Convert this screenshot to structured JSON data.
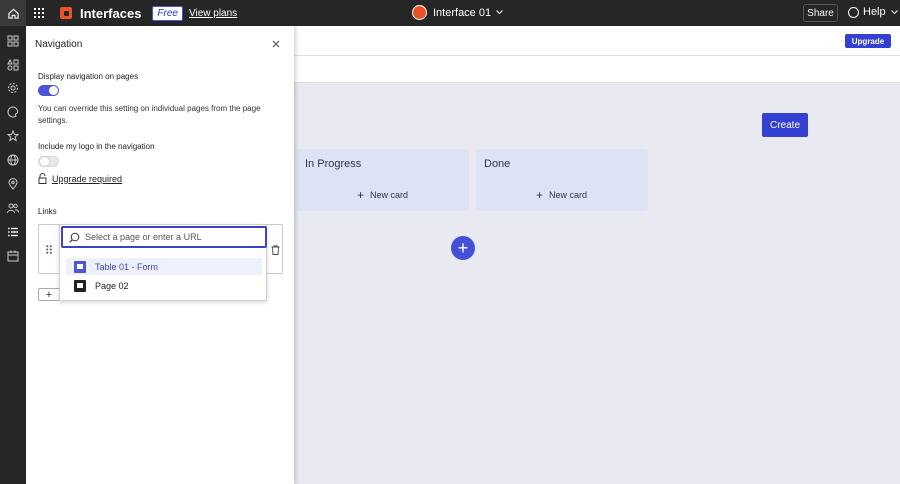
{
  "topbar": {
    "brand": "Interfaces",
    "plan_badge": "Free",
    "view_plans": "View plans",
    "interface_name": "Interface 01",
    "share": "Share",
    "help": "Help"
  },
  "background": {
    "upgrade": "Upgrade",
    "create": "Create",
    "columns": [
      {
        "title": "In Progress",
        "new_card": "New card"
      },
      {
        "title": "Done",
        "new_card": "New card"
      }
    ]
  },
  "navigation_panel": {
    "title": "Navigation",
    "display_nav_label": "Display navigation on pages",
    "display_nav_on": true,
    "override_text": "You can override this setting on individual pages from the page settings.",
    "logo_label": "Include my logo in the navigation",
    "logo_on": false,
    "upgrade_required": "Upgrade required",
    "links_label": "Links",
    "search_placeholder": "Select a page or enter a URL",
    "options": [
      {
        "label": "Table 01 - Form",
        "color": "#4b55d6",
        "highlighted": true
      },
      {
        "label": "Page 02",
        "color": "#222222",
        "highlighted": false
      }
    ]
  },
  "colors": {
    "accent": "#3340d1",
    "dark_bar": "#262626",
    "brand_orange": "#e8542a"
  }
}
